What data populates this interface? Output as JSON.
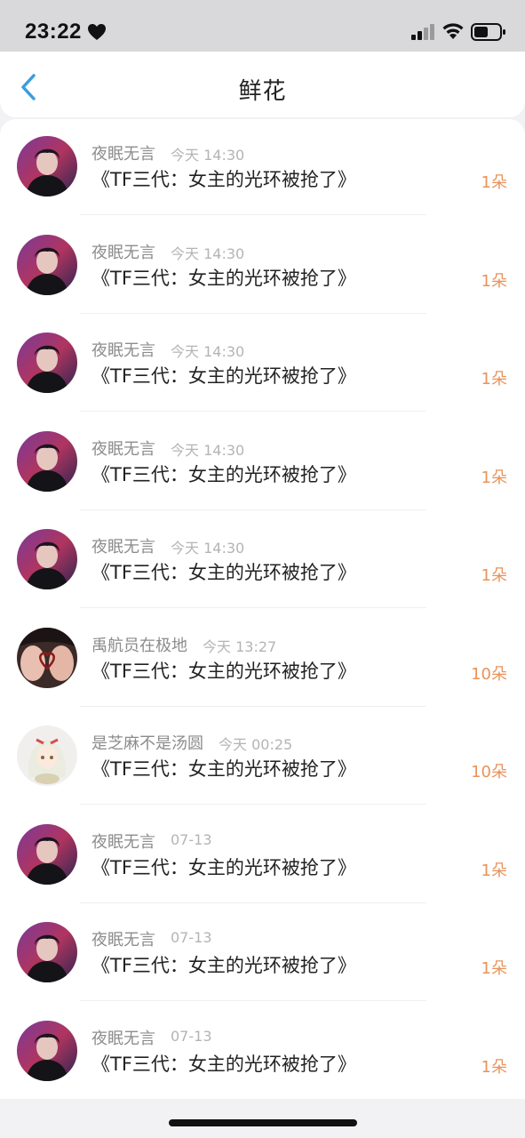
{
  "status_bar": {
    "time": "23:22",
    "heart_icon": "heart-icon",
    "signal_icon": "cellular-signal-icon",
    "wifi_icon": "wifi-icon",
    "battery_icon": "battery-icon"
  },
  "nav": {
    "back_icon": "chevron-left-icon",
    "title": "鲜花"
  },
  "colors": {
    "accent_blue": "#3a9de0",
    "count_orange": "#e8935a",
    "name_gray": "#8c8c8c",
    "time_gray": "#b4b4b4"
  },
  "rows": [
    {
      "name": "夜眠无言",
      "time": "今天 14:30",
      "title": "《TF三代：女主的光环被抢了》",
      "count": "1朵",
      "avatar": "avatar-purple"
    },
    {
      "name": "夜眠无言",
      "time": "今天 14:30",
      "title": "《TF三代：女主的光环被抢了》",
      "count": "1朵",
      "avatar": "avatar-purple"
    },
    {
      "name": "夜眠无言",
      "time": "今天 14:30",
      "title": "《TF三代：女主的光环被抢了》",
      "count": "1朵",
      "avatar": "avatar-purple"
    },
    {
      "name": "夜眠无言",
      "time": "今天 14:30",
      "title": "《TF三代：女主的光环被抢了》",
      "count": "1朵",
      "avatar": "avatar-purple"
    },
    {
      "name": "夜眠无言",
      "time": "今天 14:30",
      "title": "《TF三代：女主的光环被抢了》",
      "count": "1朵",
      "avatar": "avatar-purple"
    },
    {
      "name": "禹航员在极地",
      "time": "今天 13:27",
      "title": "《TF三代：女主的光环被抢了》",
      "count": "10朵",
      "avatar": "avatar-heart"
    },
    {
      "name": "是芝麻不是汤圆",
      "time": "今天 00:25",
      "title": "《TF三代：女主的光环被抢了》",
      "count": "10朵",
      "avatar": "avatar-anime"
    },
    {
      "name": "夜眠无言",
      "time": "07-13",
      "title": "《TF三代：女主的光环被抢了》",
      "count": "1朵",
      "avatar": "avatar-purple"
    },
    {
      "name": "夜眠无言",
      "time": "07-13",
      "title": "《TF三代：女主的光环被抢了》",
      "count": "1朵",
      "avatar": "avatar-purple"
    },
    {
      "name": "夜眠无言",
      "time": "07-13",
      "title": "《TF三代：女主的光环被抢了》",
      "count": "1朵",
      "avatar": "avatar-purple"
    }
  ]
}
